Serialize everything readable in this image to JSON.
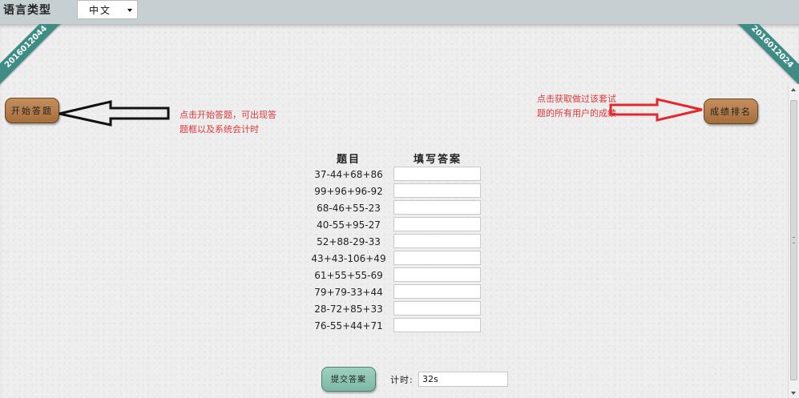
{
  "topbar": {
    "language_label": "语言类型",
    "language_selected": "中文"
  },
  "ribbons": {
    "left": "2016012044",
    "right": "2016012024"
  },
  "buttons": {
    "start": "开始答题",
    "rank": "成绩排名",
    "submit": "提交答案"
  },
  "notes": {
    "left": "点击开始答题，可出现答题框以及系统会计时",
    "right": "点击获取做过该套试题的所有用户的成绩"
  },
  "quiz": {
    "header_question": "题目",
    "header_answer": "填写答案",
    "questions": [
      "37-44+68+86",
      "99+96+96-92",
      "68-46+55-23",
      "40-55+95-27",
      "52+88-29-33",
      "43+43-106+49",
      "61+55+55-69",
      "79+79-33+44",
      "28-72+85+33",
      "76-55+44+71"
    ]
  },
  "timer": {
    "label": "计时:",
    "value": "32s"
  },
  "colors": {
    "note_red": "#e0393c",
    "ribbon_teal": "#3d8d86",
    "start_brown": "#b47a47",
    "submit_mint": "#8fc4b2"
  },
  "icons": {
    "left_arrow": "outline-arrow-left-icon",
    "right_arrow": "outline-arrow-right-icon"
  }
}
